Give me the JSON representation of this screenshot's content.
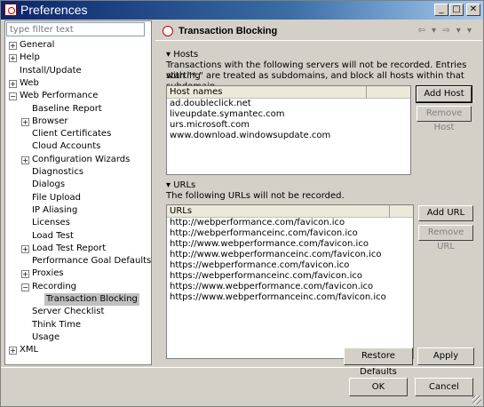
{
  "window": {
    "title": "Preferences"
  },
  "titlebar_buttons": {
    "minimize": "_",
    "maximize": "□",
    "close": "✕"
  },
  "filter": {
    "placeholder": "type filter text"
  },
  "tree": [
    {
      "label": "General",
      "expander": "+"
    },
    {
      "label": "Help",
      "expander": "+"
    },
    {
      "label": "Install/Update",
      "expander": ""
    },
    {
      "label": "Web",
      "expander": "+"
    },
    {
      "label": "Web Performance",
      "expander": "−"
    },
    {
      "label": "Baseline Report",
      "expander": ""
    },
    {
      "label": "Browser",
      "expander": "+"
    },
    {
      "label": "Client Certificates",
      "expander": ""
    },
    {
      "label": "Cloud Accounts",
      "expander": ""
    },
    {
      "label": "Configuration Wizards",
      "expander": "+"
    },
    {
      "label": "Diagnostics",
      "expander": ""
    },
    {
      "label": "Dialogs",
      "expander": ""
    },
    {
      "label": "File Upload",
      "expander": ""
    },
    {
      "label": "IP Aliasing",
      "expander": ""
    },
    {
      "label": "Licenses",
      "expander": ""
    },
    {
      "label": "Load Test",
      "expander": ""
    },
    {
      "label": "Load Test Report",
      "expander": "+"
    },
    {
      "label": "Performance Goal Defaults",
      "expander": ""
    },
    {
      "label": "Proxies",
      "expander": "+"
    },
    {
      "label": "Recording",
      "expander": "−"
    },
    {
      "label": "Transaction Blocking",
      "expander": ""
    },
    {
      "label": "Server Checklist",
      "expander": ""
    },
    {
      "label": "Think Time",
      "expander": ""
    },
    {
      "label": "Usage",
      "expander": ""
    },
    {
      "label": "XML",
      "expander": "+"
    }
  ],
  "page": {
    "title": "Transaction Blocking",
    "nav_arrows": "⇦ ▾ ⇨ ▾ ▾"
  },
  "hosts": {
    "section_label": "Hosts",
    "description_line1": "Transactions with the following servers will not be recorded. Entries starting",
    "description_line2": "with \"*.\" are treated as subdomains, and block all hosts within that subdomain.",
    "column_header": "Host names",
    "rows": [
      "ad.doubleclick.net",
      "liveupdate.symantec.com",
      "urs.microsoft.com",
      "www.download.windowsupdate.com"
    ],
    "add_label": "Add Host",
    "remove_label": "Remove Host"
  },
  "urls": {
    "section_label": "URLs",
    "description": "The following URLs will not be recorded.",
    "column_header": "URLs",
    "rows": [
      "http://webperformance.com/favicon.ico",
      "http://webperformanceinc.com/favicon.ico",
      "http://www.webperformance.com/favicon.ico",
      "http://www.webperformanceinc.com/favicon.ico",
      "https://webperformance.com/favicon.ico",
      "https://webperformanceinc.com/favicon.ico",
      "https://www.webperformance.com/favicon.ico",
      "https://www.webperformanceinc.com/favicon.ico"
    ],
    "add_label": "Add URL",
    "remove_label": "Remove URL"
  },
  "buttons": {
    "restore_defaults": "Restore Defaults",
    "apply": "Apply",
    "ok": "OK",
    "cancel": "Cancel"
  }
}
